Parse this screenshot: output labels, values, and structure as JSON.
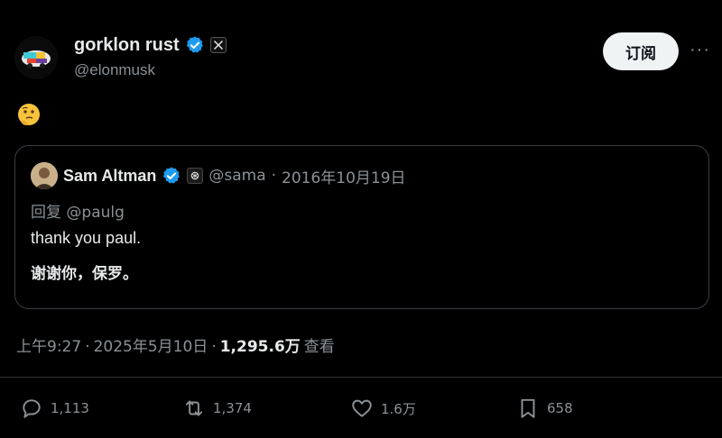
{
  "author": {
    "display_name": "gorklon rust",
    "handle": "@elonmusk",
    "avatar_icon": "gorklon-logo-icon",
    "verified_icon": "verified-badge-icon",
    "platform_badge_icon": "x-logo-icon"
  },
  "header": {
    "subscribe_label": "订阅",
    "more_label": "···"
  },
  "post": {
    "emoji_icon": "thinking-face-emoji"
  },
  "quote": {
    "display_name": "Sam Altman",
    "handle": "@sama",
    "separator": "·",
    "date": "2016年10月19日",
    "reply_prefix": "回复",
    "reply_to": "@paulg",
    "text_en": "thank you paul.",
    "text_zh": "谢谢你，保罗。",
    "affiliation_icon": "openai-logo-icon"
  },
  "meta": {
    "time": "上午9:27",
    "sep1": "·",
    "date": "2025年5月10日",
    "sep2": "·",
    "views": "1,295.6万",
    "views_label": "查看"
  },
  "actions": {
    "reply_count": "1,113",
    "repost_count": "1,374",
    "like_count": "1.6万",
    "bookmark_count": "658"
  },
  "colors": {
    "background": "#000000",
    "verified_blue": "#1d9bf0",
    "muted_text": "#8b9196",
    "primary_text": "#e7e9ea"
  }
}
